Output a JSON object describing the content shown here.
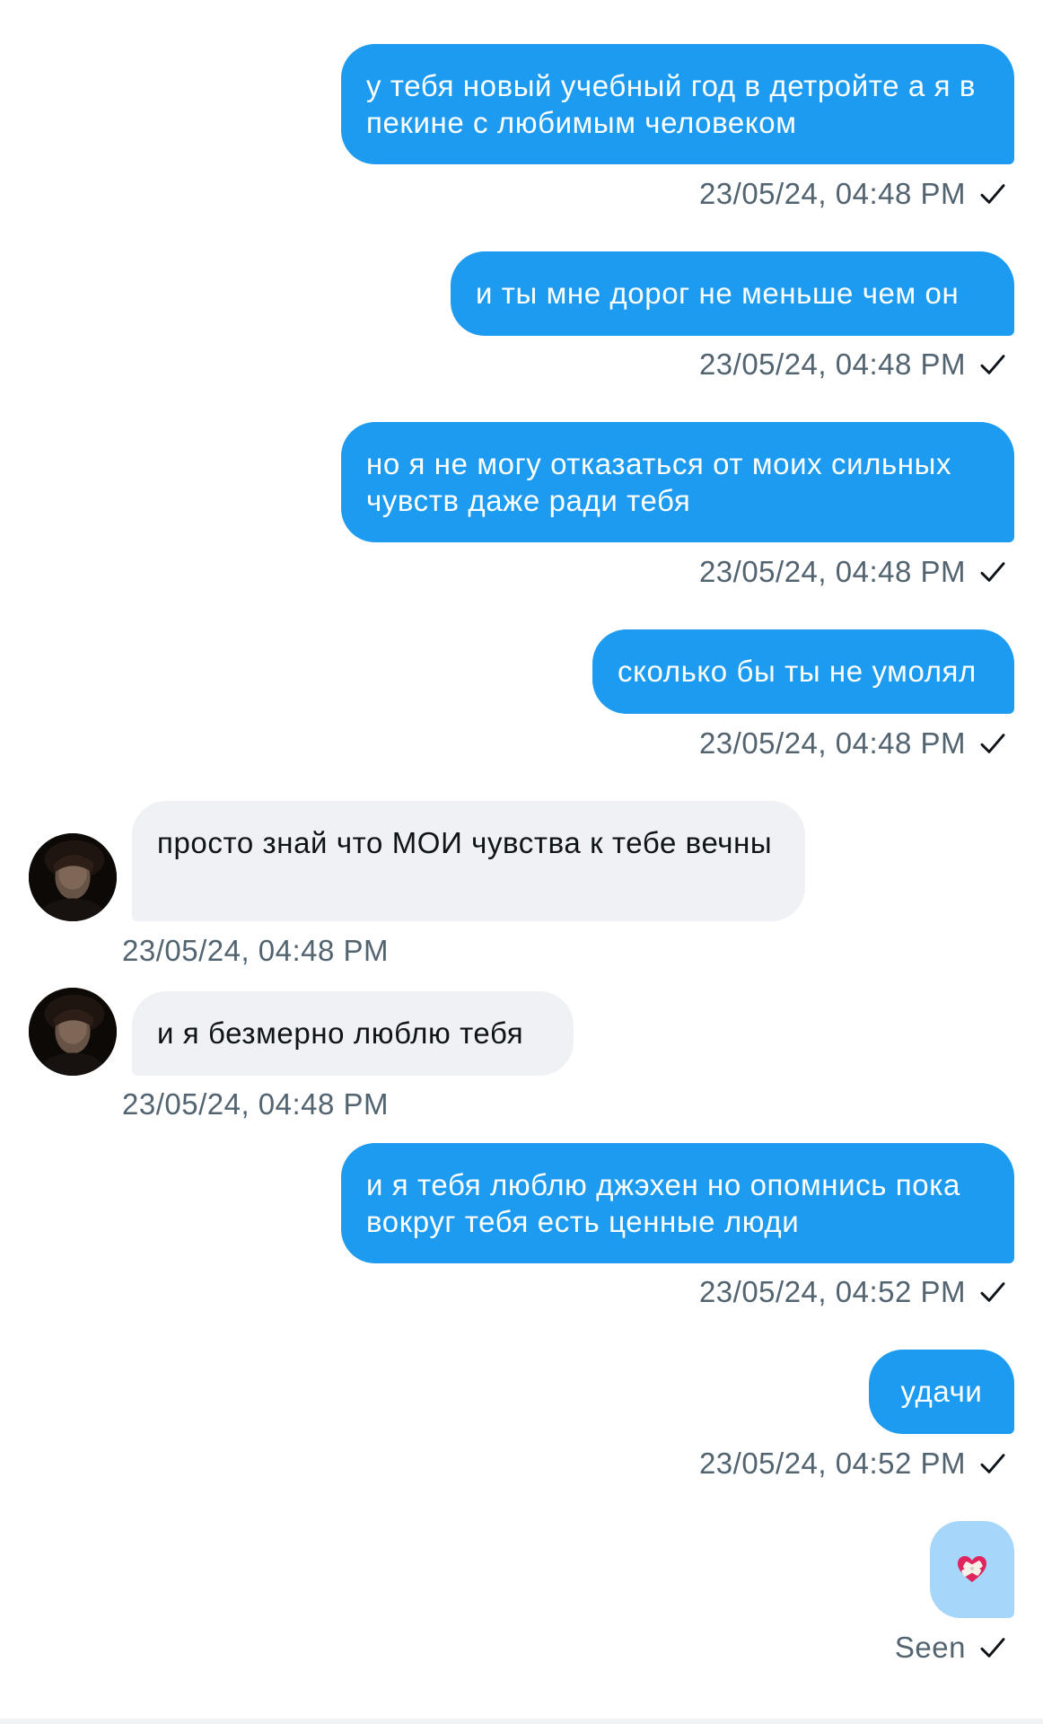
{
  "messages": [
    {
      "side": "out",
      "text": "у тебя новый учебный год в детройте а я в пекине с любимым человеком",
      "time": "23/05/24, 04:48 PM"
    },
    {
      "side": "out",
      "text": "и ты мне дорог не меньше чем он",
      "time": "23/05/24, 04:48 PM"
    },
    {
      "side": "out",
      "text": "но я не могу отказаться от моих сильных чувств даже ради тебя",
      "time": "23/05/24, 04:48 PM"
    },
    {
      "side": "out",
      "text": "сколько бы ты не умолял",
      "time": "23/05/24, 04:48 PM"
    },
    {
      "side": "in",
      "text": "просто знай что МОИ чувства к тебе вечны",
      "time": "23/05/24, 04:48 PM"
    },
    {
      "side": "in",
      "text": "и я безмерно люблю тебя",
      "time": "23/05/24, 04:48 PM"
    },
    {
      "side": "out",
      "text": "и я тебя люблю джэхен но опомнись пока вокруг тебя есть ценные люди",
      "time": "23/05/24, 04:52 PM"
    },
    {
      "side": "out",
      "text": "удачи",
      "time": "23/05/24, 04:52 PM"
    }
  ],
  "reaction": {
    "emoji": "heart-bandaged-icon"
  },
  "status": {
    "seen_label": "Seen"
  },
  "icons": {
    "check": "check-icon",
    "avatar": "contact-avatar"
  },
  "colors": {
    "outgoing_bubble": "#1d9bf0",
    "incoming_bubble": "#eff1f4",
    "reaction_bubble": "#a6d7fb",
    "timestamp": "#536471"
  }
}
